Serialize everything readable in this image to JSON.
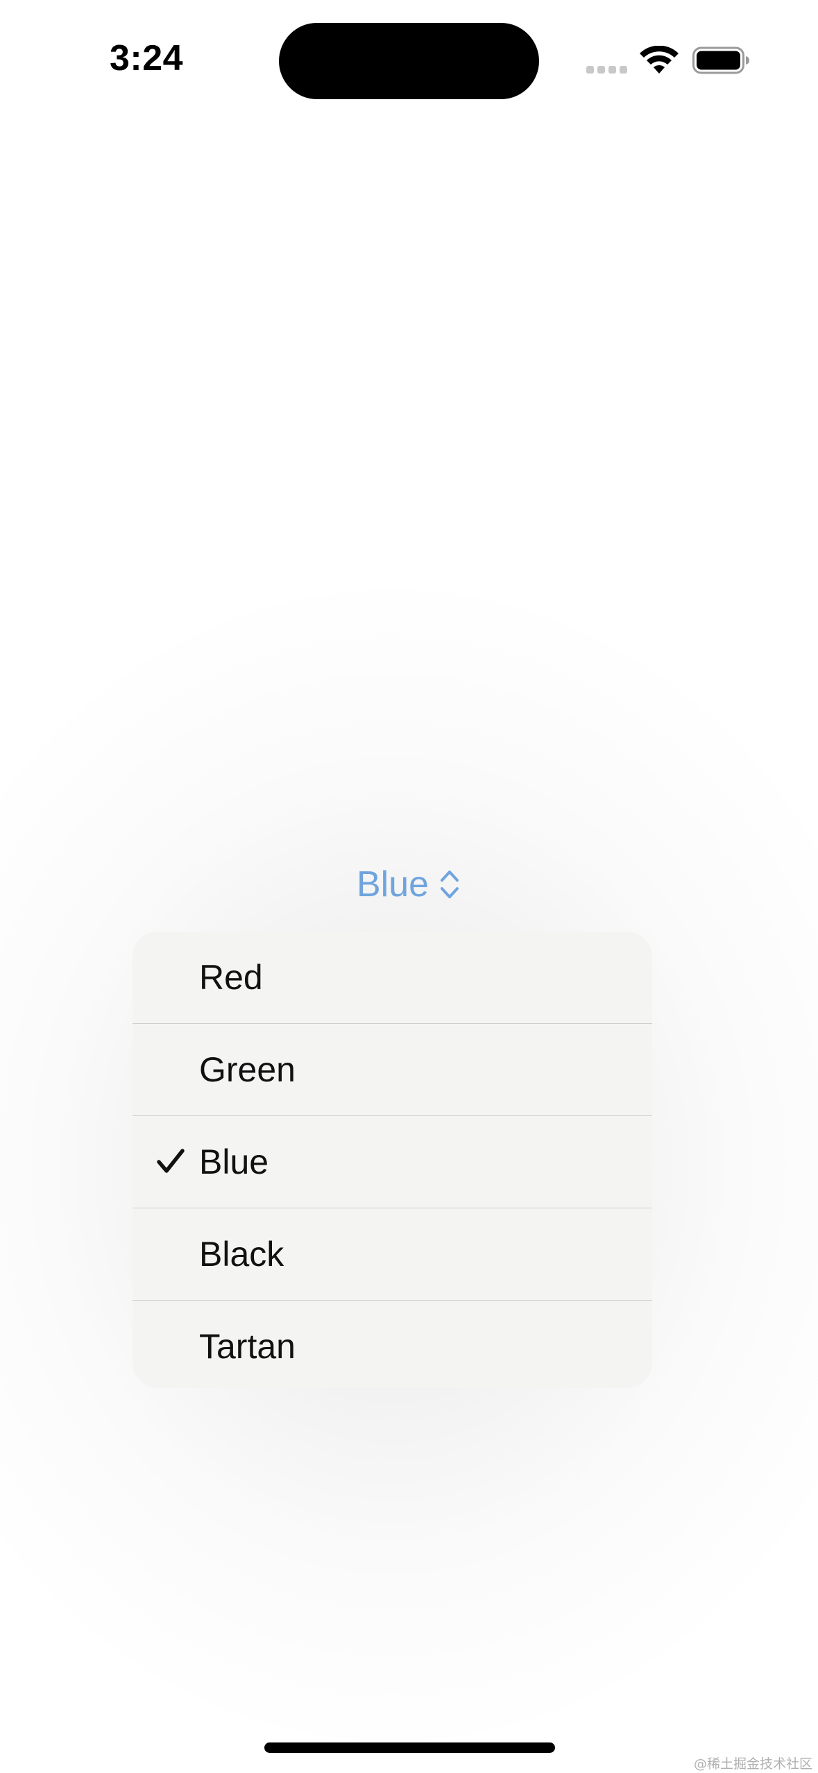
{
  "status_bar": {
    "time": "3:24"
  },
  "picker": {
    "selected_label": "Blue",
    "accent_color": "#6fa4de",
    "icon": "chevron-up-down-icon"
  },
  "menu": {
    "items": [
      {
        "label": "Red",
        "selected": false
      },
      {
        "label": "Green",
        "selected": false
      },
      {
        "label": "Blue",
        "selected": true
      },
      {
        "label": "Black",
        "selected": false
      },
      {
        "label": "Tartan",
        "selected": false
      }
    ],
    "check_icon": "checkmark-icon"
  },
  "watermark": "@稀土掘金技术社区"
}
